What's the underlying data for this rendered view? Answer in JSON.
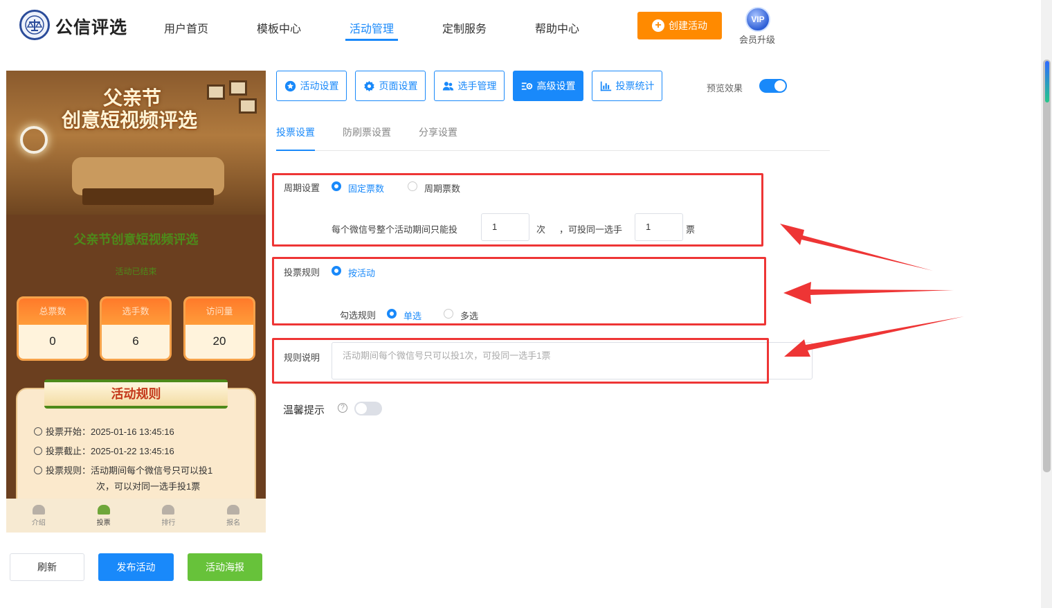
{
  "header": {
    "logo_text": "公信评选",
    "nav": [
      {
        "label": "用户首页"
      },
      {
        "label": "模板中心"
      },
      {
        "label": "活动管理",
        "active": true
      },
      {
        "label": "定制服务"
      },
      {
        "label": "帮助中心"
      }
    ],
    "create_button": "创建活动",
    "vip_badge": "VIP",
    "vip_label": "会员升级"
  },
  "preview": {
    "banner_line1": "父亲节",
    "banner_line2": "创意短视频评选",
    "activity_title": "父亲节创意短视频评选",
    "activity_status": "活动已结束",
    "stats": [
      {
        "label": "总票数",
        "value": "0"
      },
      {
        "label": "选手数",
        "value": "6"
      },
      {
        "label": "访问量",
        "value": "20"
      }
    ],
    "rules_title": "活动规则",
    "rules": {
      "start_label": "投票开始：",
      "start_value": "2025-01-16 13:45:16",
      "end_label": "投票截止：",
      "end_value": "2025-01-22 13:45:16",
      "rule_label": "投票规则：",
      "rule_value_1": "活动期间每个微信号只可以投1",
      "rule_value_2": "次，可以对同一选手投1票"
    },
    "bottom_tabs": [
      {
        "label": "介绍"
      },
      {
        "label": "投票",
        "active": true
      },
      {
        "label": "排行"
      },
      {
        "label": "报名"
      }
    ]
  },
  "actions": {
    "refresh": "刷新",
    "publish": "发布活动",
    "poster": "活动海报"
  },
  "settings_tabs": [
    {
      "label": "活动设置",
      "icon": "star-icon"
    },
    {
      "label": "页面设置",
      "icon": "gear-icon"
    },
    {
      "label": "选手管理",
      "icon": "users-icon"
    },
    {
      "label": "高级设置",
      "icon": "sliders-icon",
      "active": true
    },
    {
      "label": "投票统计",
      "icon": "bar-chart-icon"
    }
  ],
  "preview_toggle": {
    "label": "预览效果",
    "on": true
  },
  "sub_tabs": [
    {
      "label": "投票设置",
      "active": true
    },
    {
      "label": "防刷票设置"
    },
    {
      "label": "分享设置"
    }
  ],
  "cycle": {
    "label": "周期设置",
    "option_fixed": "固定票数",
    "option_period": "周期票数",
    "selected": "固定票数",
    "sentence_prefix": "每个微信号整个活动期间只能投",
    "times_value": "1",
    "times_unit": "次",
    "sentence_middle": "，可投同一选手",
    "votes_value": "1",
    "votes_unit": "票"
  },
  "vote_rule": {
    "label": "投票规则",
    "option": "按活动",
    "select_label": "勾选规则",
    "option_single": "单选",
    "option_multi": "多选",
    "selected": "单选"
  },
  "rule_desc": {
    "label": "规则说明",
    "placeholder": "活动期间每个微信号只可以投1次，可投同一选手1票"
  },
  "tips": {
    "label": "温馨提示",
    "help": "?",
    "on": false
  },
  "colors": {
    "accent": "#1989fa",
    "orange": "#ff8a00",
    "green": "#67c23a",
    "highlight_red": "#ee3535"
  }
}
